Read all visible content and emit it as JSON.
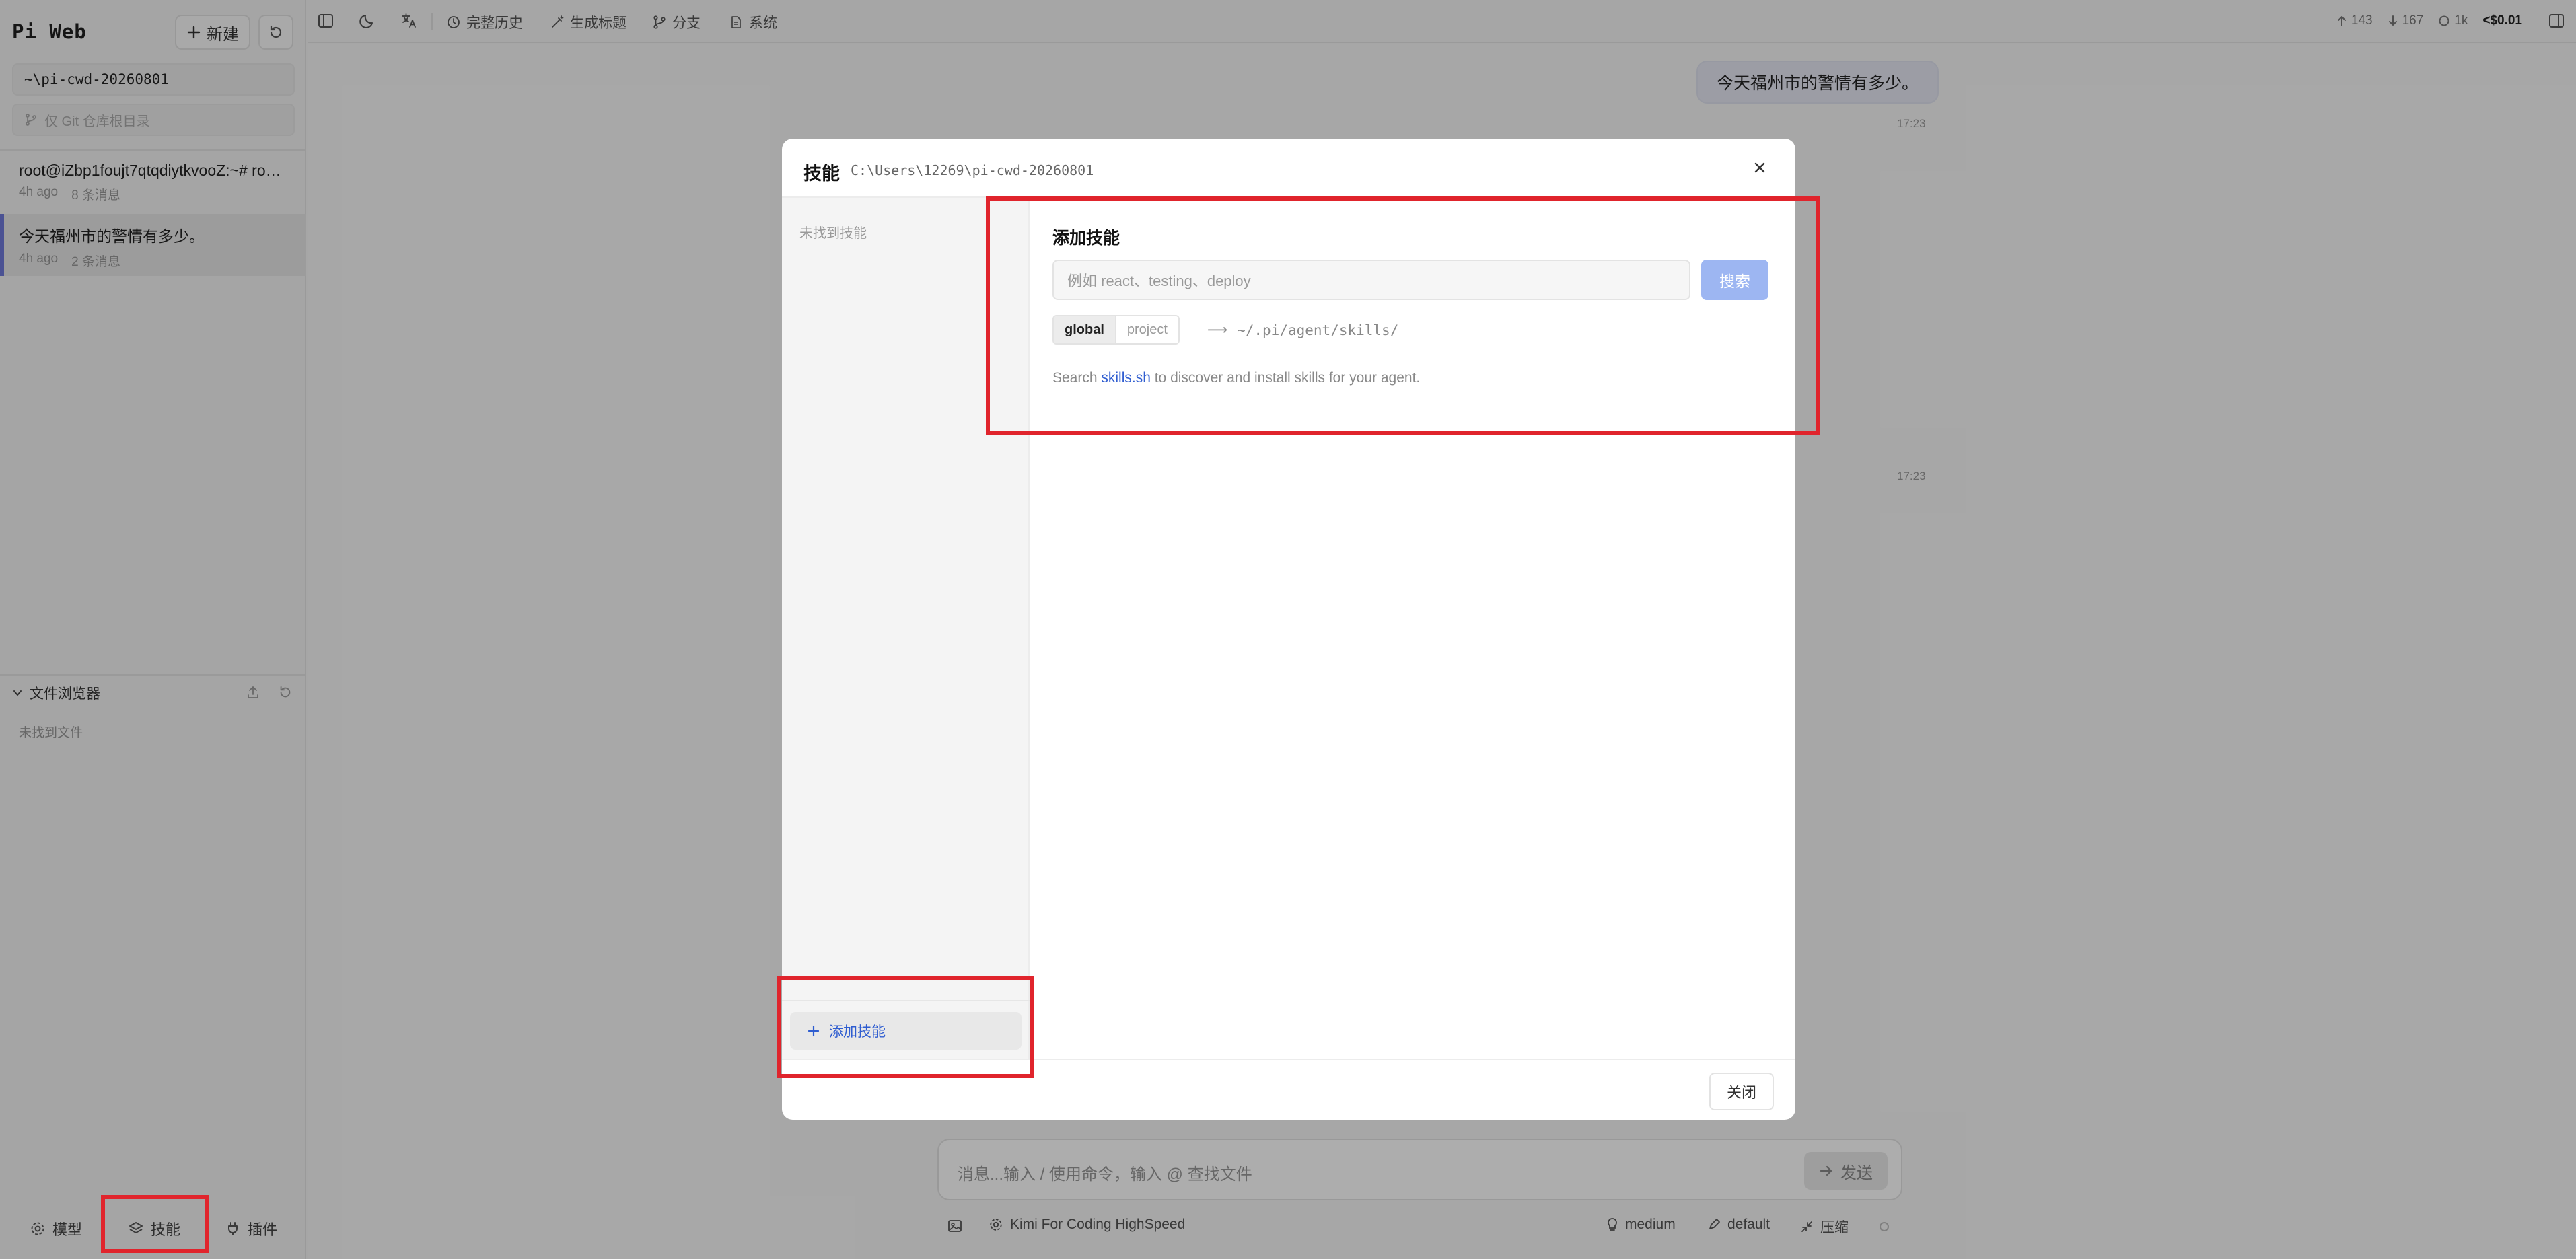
{
  "sidebar": {
    "brand": "Pi Web",
    "new_label": "新建",
    "cwd_value": "~\\pi-cwd-20260801",
    "git_placeholder": "仅 Git 仓库根目录",
    "sessions": [
      {
        "title": "root@iZbp1foujt7qtqdiytkvooZ:~# root@i...",
        "age": "4h ago",
        "count": "8 条消息"
      },
      {
        "title": "今天福州市的警情有多少。",
        "age": "4h ago",
        "count": "2 条消息"
      }
    ],
    "file_browser": {
      "title": "文件浏览器",
      "empty": "未找到文件"
    },
    "bottom": {
      "models": "模型",
      "skills": "技能",
      "plugins": "插件"
    }
  },
  "topbar": {
    "full_history": "完整历史",
    "gen_title": "生成标题",
    "branch": "分支",
    "system": "系统",
    "stats": {
      "up": "143",
      "down": "167",
      "ctx": "1k",
      "cost": "<$0.01"
    }
  },
  "chat": {
    "user_message": "今天福州市的警情有多少。",
    "time1": "17:23",
    "time2": "17:23",
    "composer_placeholder": "消息...输入 / 使用命令，输入 @ 查找文件",
    "send_label": "发送",
    "model_name": "Kimi For Coding HighSpeed",
    "thinking": "medium",
    "mode": "default",
    "compress": "压缩"
  },
  "modal": {
    "title": "技能",
    "path": "C:\\Users\\12269\\pi-cwd-20260801",
    "left_empty": "未找到技能",
    "add_skill_button": "添加技能",
    "add_title": "添加技能",
    "search_placeholder": "例如 react、testing、deploy",
    "search_button": "搜索",
    "scope_global": "global",
    "scope_project": "project",
    "arrow": "⟶",
    "install_path": "~/.pi/agent/skills/",
    "hint_prefix": "Search ",
    "hint_link": "skills.sh",
    "hint_suffix": " to discover and install skills for your agent.",
    "close_button": "关闭"
  },
  "colors": {
    "accent": "#2f5dd0",
    "search_button": "#9db6f2",
    "highlight": "#e0242c",
    "active_session": "#6f7ad9"
  }
}
